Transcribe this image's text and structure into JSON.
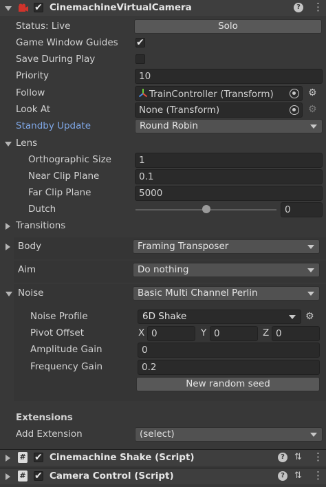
{
  "component": {
    "title": "CinemachineVirtualCamera",
    "enabled": true
  },
  "status": {
    "label": "Status: Live",
    "solo_label": "Solo"
  },
  "game_window_guides": {
    "label": "Game Window Guides",
    "checked": true
  },
  "save_during_play": {
    "label": "Save During Play",
    "checked": false
  },
  "priority": {
    "label": "Priority",
    "value": "10"
  },
  "follow": {
    "label": "Follow",
    "value": "TrainController (Transform)"
  },
  "look_at": {
    "label": "Look At",
    "value": "None (Transform)"
  },
  "standby_update": {
    "label": "Standby Update",
    "value": "Round Robin",
    "label_color": "#7fa7e6"
  },
  "lens": {
    "label": "Lens",
    "orthographic_size": {
      "label": "Orthographic Size",
      "value": "1"
    },
    "near_clip_plane": {
      "label": "Near Clip Plane",
      "value": "0.1"
    },
    "far_clip_plane": {
      "label": "Far Clip Plane",
      "value": "5000"
    },
    "dutch": {
      "label": "Dutch",
      "value": "0",
      "slider_fraction": 0.5
    }
  },
  "transitions": {
    "label": "Transitions"
  },
  "body": {
    "label": "Body",
    "value": "Framing Transposer"
  },
  "aim": {
    "label": "Aim",
    "value": "Do nothing"
  },
  "noise": {
    "label": "Noise",
    "value": "Basic Multi Channel Perlin",
    "noise_profile": {
      "label": "Noise Profile",
      "value": "6D Shake"
    },
    "pivot_offset": {
      "label": "Pivot Offset",
      "x_label": "X",
      "x": "0",
      "y_label": "Y",
      "y": "0",
      "z_label": "Z",
      "z": "0"
    },
    "amplitude_gain": {
      "label": "Amplitude Gain",
      "value": "0"
    },
    "frequency_gain": {
      "label": "Frequency Gain",
      "value": "0.2"
    },
    "new_seed_label": "New random seed"
  },
  "extensions": {
    "heading": "Extensions",
    "add_label": "Add Extension",
    "add_value": "(select)"
  },
  "components": [
    {
      "title": "Cinemachine Shake (Script)",
      "enabled": true
    },
    {
      "title": "Camera Control (Script)",
      "enabled": true
    }
  ]
}
